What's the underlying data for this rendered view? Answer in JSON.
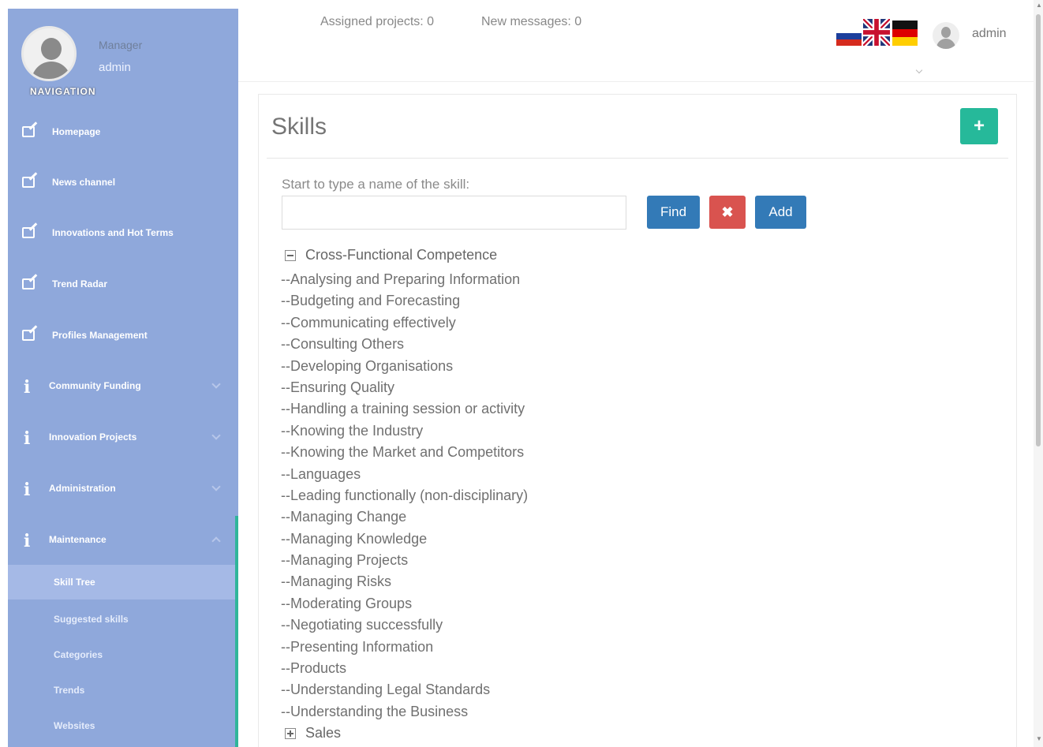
{
  "sidebar": {
    "role": "Manager",
    "username": "admin",
    "nav_title": "NAVIGATION",
    "items": [
      {
        "label": "Homepage",
        "icon": "edit-icon"
      },
      {
        "label": "News channel",
        "icon": "edit-icon"
      },
      {
        "label": "Innovations and Hot Terms",
        "icon": "edit-icon"
      },
      {
        "label": "Trend Radar",
        "icon": "edit-icon"
      },
      {
        "label": "Profiles Management",
        "icon": "edit-icon"
      },
      {
        "label": "Community Funding",
        "icon": "info-icon"
      },
      {
        "label": "Innovation Projects",
        "icon": "info-icon"
      },
      {
        "label": "Administration",
        "icon": "info-icon"
      },
      {
        "label": "Maintenance",
        "icon": "info-icon"
      }
    ],
    "sub_items": [
      {
        "label": "Skill Tree",
        "active": true
      },
      {
        "label": "Suggested skills"
      },
      {
        "label": "Categories"
      },
      {
        "label": "Trends"
      },
      {
        "label": "Websites"
      }
    ],
    "accent_color": "#2fb59a",
    "bg_color": "#8fa8db"
  },
  "topbar": {
    "assigned_projects": "Assigned projects: 0",
    "new_messages": "New messages: 0",
    "username": "admin",
    "languages": [
      "ru-flag-icon",
      "uk-flag-icon",
      "de-flag-icon"
    ]
  },
  "panel": {
    "title": "Skills",
    "add_icon": "+",
    "search_label": "Start to type a name of the skill:",
    "search_value": "",
    "find_label": "Find",
    "clear_label": "✖",
    "add_label": "Add"
  },
  "tree": {
    "root": "Cross-Functional Competence",
    "children": [
      "--Analysing and Preparing Information",
      "--Budgeting and Forecasting",
      "--Communicating effectively",
      "--Consulting Others",
      "--Developing Organisations",
      "--Ensuring Quality",
      "--Handling a training session or activity",
      "--Knowing the Industry",
      "--Knowing the Market and Competitors",
      "--Languages",
      "--Leading functionally (non-disciplinary)",
      "--Managing Change",
      "--Managing Knowledge",
      "--Managing Projects",
      "--Managing Risks",
      "--Moderating Groups",
      "--Negotiating successfully",
      "--Presenting Information",
      "--Products",
      "--Understanding Legal Standards",
      "--Understanding the Business"
    ],
    "collapsed_root": "Sales"
  },
  "colors": {
    "primary": "#337ab7",
    "danger": "#d9534f",
    "success": "#26b99a"
  }
}
